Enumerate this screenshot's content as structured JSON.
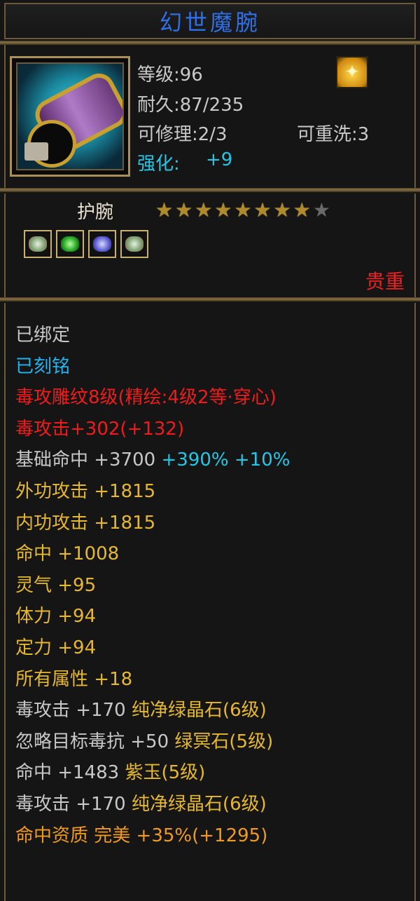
{
  "title": "幻世魔腕",
  "stats": {
    "level": "等级:96",
    "durability": "耐久:87/235",
    "repair": "可修理:2/3",
    "rewash": "可重洗:3",
    "enhance_label": "强化:",
    "enhance_value": "+9"
  },
  "item_type": "护腕",
  "stars": {
    "filled": 8,
    "total": 9
  },
  "gem_slots": [
    "white-gem-icon",
    "green-gem-icon",
    "purple-gem-icon",
    "white-gem-icon"
  ],
  "rarity": "贵重",
  "attributes": {
    "bound": "已绑定",
    "engraved": "已刻铭",
    "carving": "毒攻雕纹8级(精绘:4级2等·穿心)",
    "poison_attack": "毒攻击+302(+132)",
    "base_hit": "基础命中 +3700",
    "base_hit_bonus": "+390% +10%",
    "outer_attack": "外功攻击 +1815",
    "inner_attack": "内功攻击 +1815",
    "hit": "命中 +1008",
    "spirit": "灵气 +95",
    "stamina": "体力 +94",
    "focus": "定力 +94",
    "all_attrs": "所有属性 +18",
    "gem1_stat": "毒攻击 +170",
    "gem1_name": "纯净绿晶石(6级)",
    "gem2_stat": "忽略目标毒抗 +50",
    "gem2_name": "绿冥石(5级)",
    "gem3_stat": "命中 +1483",
    "gem3_name": "紫玉(5级)",
    "gem4_stat": "毒攻击 +170",
    "gem4_name": "纯净绿晶石(6级)",
    "quality": "命中资质  完美 +35%(+1295)"
  },
  "colors": {
    "title": "#2f6fe8",
    "enhance": "#23c8e8",
    "engraved": "#23b4f0",
    "red": "#f01c1c",
    "yellow": "#e6b830",
    "orange": "#f09a20",
    "rarity": "#f02020"
  }
}
